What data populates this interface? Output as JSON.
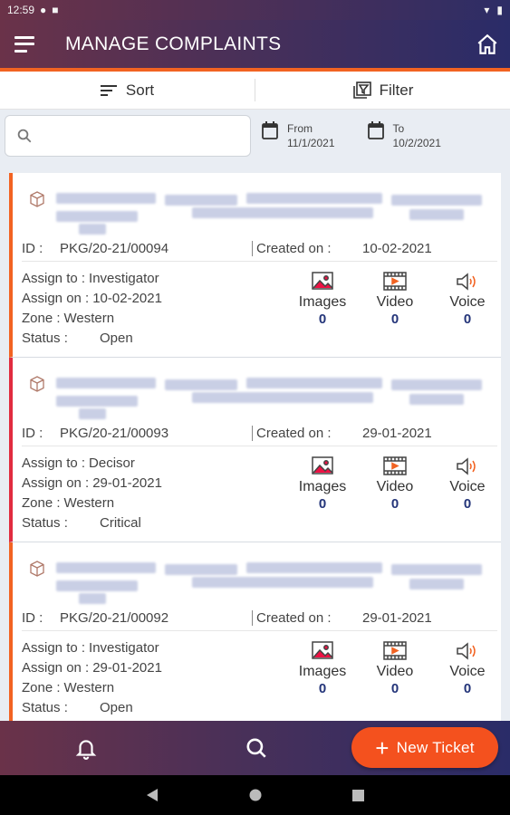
{
  "status_bar": {
    "time": "12:59"
  },
  "header": {
    "title": "MANAGE COMPLAINTS"
  },
  "toolbar": {
    "sort_label": "Sort",
    "filter_label": "Filter"
  },
  "search": {
    "placeholder": "",
    "value": ""
  },
  "date_range": {
    "from_label": "From",
    "from_value": "11/1/2021",
    "to_label": "To",
    "to_value": "10/2/2021"
  },
  "labels": {
    "id": "ID :",
    "created_on": "Created on :",
    "assign_to": "Assign to :",
    "assign_on": "Assign on :",
    "zone": "Zone :",
    "status": "Status :",
    "images": "Images",
    "video": "Video",
    "voice": "Voice"
  },
  "tickets": [
    {
      "id": "PKG/20-21/00094",
      "created_on": "10-02-2021",
      "assign_to": "Investigator",
      "assign_on": "10-02-2021",
      "zone": "Western",
      "status": "Open",
      "images": "0",
      "video": "0",
      "voice": "0"
    },
    {
      "id": "PKG/20-21/00093",
      "created_on": "29-01-2021",
      "assign_to": "Decisor",
      "assign_on": "29-01-2021",
      "zone": "Western",
      "status": "Critical",
      "images": "0",
      "video": "0",
      "voice": "0"
    },
    {
      "id": "PKG/20-21/00092",
      "created_on": "29-01-2021",
      "assign_to": "Investigator",
      "assign_on": "29-01-2021",
      "zone": "Western",
      "status": "Open",
      "images": "0",
      "video": "0",
      "voice": "0"
    }
  ],
  "new_ticket": {
    "label": "New Ticket"
  },
  "colors": {
    "accent": "#f26322",
    "critical": "#e12b3f",
    "count": "#233479"
  },
  "icons": {
    "menu": "hamburger-icon",
    "home": "home-icon",
    "sort": "sort-icon",
    "filter": "filter-icon",
    "search": "search-icon",
    "calendar": "calendar-icon",
    "package": "package-icon",
    "image": "image-icon",
    "video": "video-icon",
    "voice": "speaker-icon",
    "bell": "bell-icon",
    "search_nav": "search-icon",
    "plus": "plus-icon"
  }
}
